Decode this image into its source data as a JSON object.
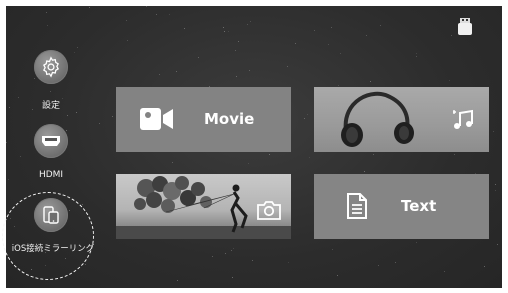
{
  "sidebar": {
    "items": [
      {
        "label": "設定",
        "icon": "gear-icon"
      },
      {
        "label": "HDMI",
        "icon": "hdmi-icon"
      },
      {
        "label": "iOS接続ミラーリング",
        "icon": "phone-mirror-icon"
      }
    ]
  },
  "status": {
    "usb_icon": "usb-drive-icon"
  },
  "tiles": {
    "movie": {
      "label": "Movie",
      "icon": "video-camera-icon"
    },
    "music": {
      "icon": "music-note-icon"
    },
    "photo": {
      "icon": "camera-icon"
    },
    "text": {
      "label": "Text",
      "icon": "document-icon"
    }
  },
  "colors": {
    "background": "#2f2f2f",
    "tile": "#7f7f7f",
    "text": "#ffffff"
  }
}
